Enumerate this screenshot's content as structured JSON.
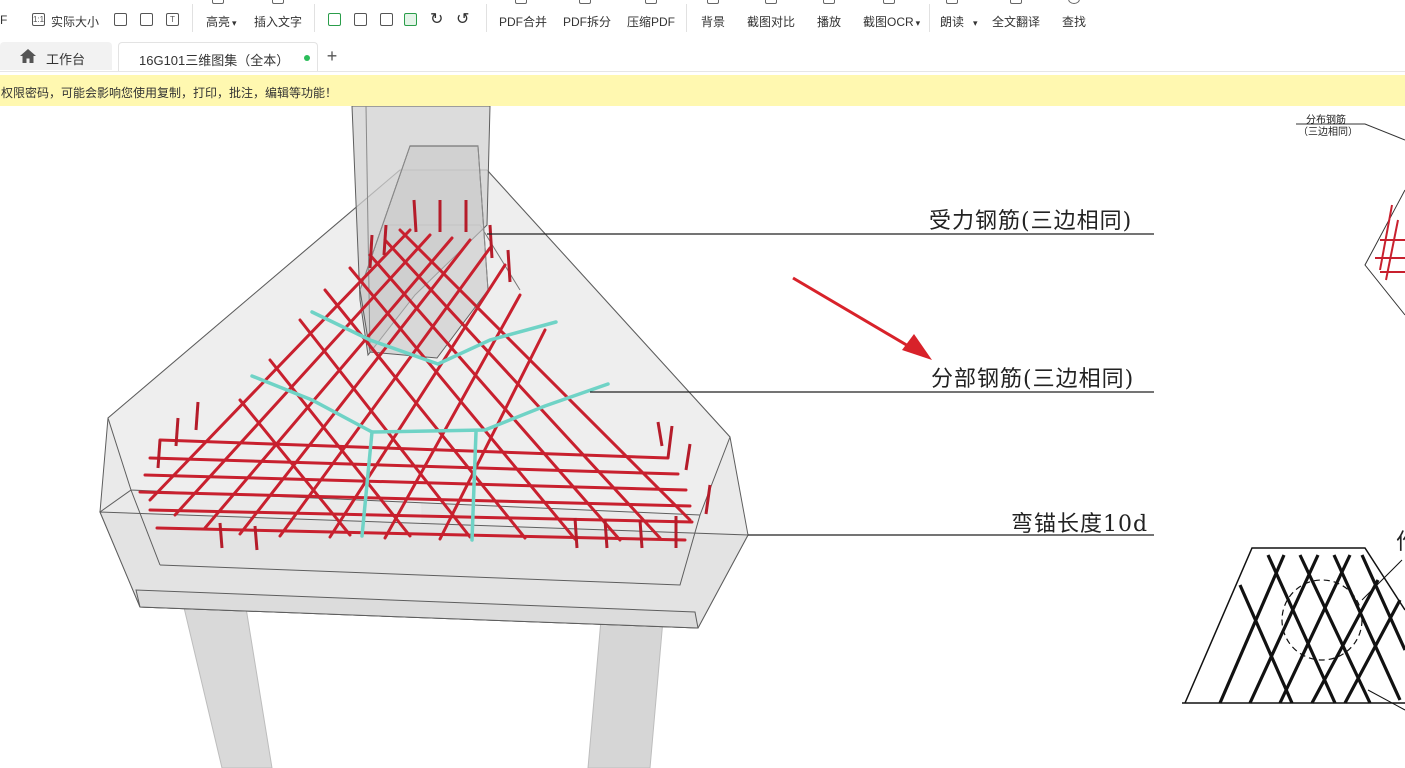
{
  "toolbar": {
    "items": [
      {
        "label": "实际大小",
        "icon": "actual-size-icon"
      },
      {
        "label": "高亮",
        "icon": "highlight-icon"
      },
      {
        "label": "插入文字",
        "icon": "insert-text-icon"
      },
      {
        "label": "PDF合并",
        "icon": "pdf-merge-icon"
      },
      {
        "label": "PDF拆分",
        "icon": "pdf-split-icon"
      },
      {
        "label": "压缩PDF",
        "icon": "compress-pdf-icon"
      },
      {
        "label": "背景",
        "icon": "background-icon"
      },
      {
        "label": "截图对比",
        "icon": "screenshot-compare-icon"
      },
      {
        "label": "播放",
        "icon": "play-icon"
      },
      {
        "label": "截图OCR",
        "icon": "screenshot-ocr-icon"
      },
      {
        "label": "朗读",
        "icon": "read-aloud-icon"
      },
      {
        "label": "全文翻译",
        "icon": "translate-icon"
      },
      {
        "label": "查找",
        "icon": "search-icon"
      }
    ],
    "left_fragment": "F",
    "actual_size_glyph": "1:1",
    "text_glyph": "T"
  },
  "tabs": {
    "home_label": "工作台",
    "doc_label": "16G101三维图集（全本）",
    "add_label": "+"
  },
  "notice": {
    "text": "权限密码，可能会影响您使用复制，打印，批注，编辑等功能！"
  },
  "drawing": {
    "callout_1": "受力钢筋(三边相同)",
    "callout_2": "分部钢筋(三边相同)",
    "callout_3": "弯锚长度10d",
    "side_note_1": "分布钢筋",
    "side_note_2": "（三边相同）",
    "side_fragment": "作",
    "colors": {
      "rebar_main": "#c8202e",
      "rebar_distribution": "#6fd3c6",
      "concrete_edge": "#5e5e5e",
      "arrow": "#d8222a"
    }
  }
}
